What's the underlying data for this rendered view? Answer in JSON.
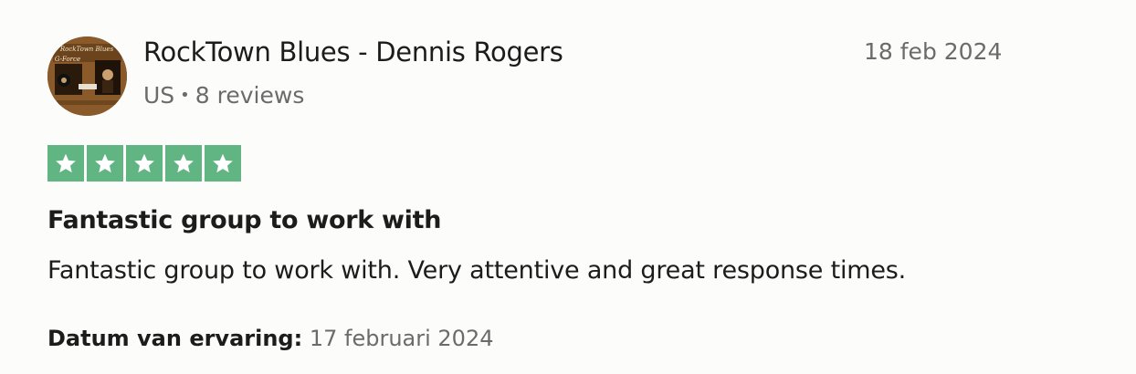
{
  "reviewer": {
    "name": "RockTown Blues - Dennis Rogers",
    "country": "US",
    "separator": "•",
    "reviews_count": "8 reviews",
    "avatar_text": {
      "line1": "RockTown Blues",
      "line2": "G-Force"
    }
  },
  "review": {
    "date": "18 feb 2024",
    "rating": 5,
    "rating_max": 5,
    "star_color": "#60b583",
    "title": "Fantastic group to work with",
    "body": "Fantastic group to work with. Very attentive and great response times.",
    "experience_label": "Datum van ervaring:",
    "experience_date": "17 februari 2024"
  }
}
